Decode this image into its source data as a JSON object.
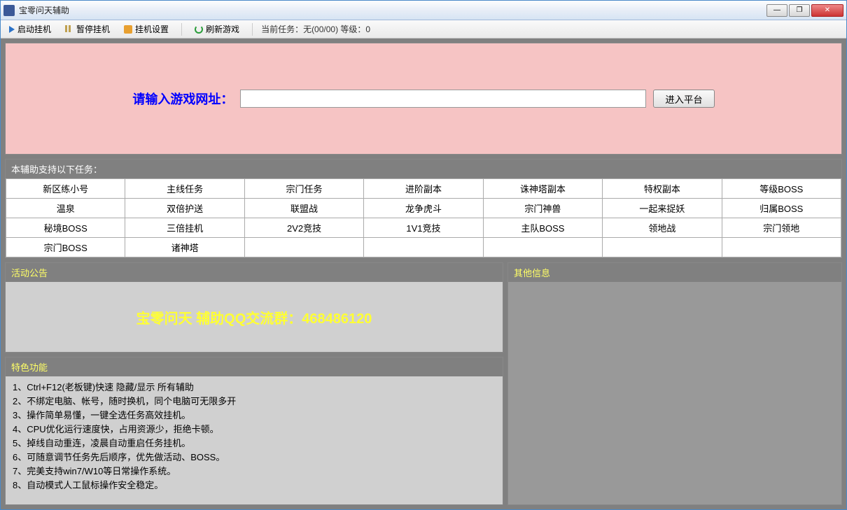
{
  "window": {
    "title": "宝零问天辅助"
  },
  "toolbar": {
    "start": "启动挂机",
    "pause": "暂停挂机",
    "settings": "挂机设置",
    "refresh": "刷新游戏",
    "status": "当前任务：无(00/00) 等级：0"
  },
  "url_panel": {
    "label": "请输入游戏网址：",
    "value": "",
    "button": "进入平台"
  },
  "tasks": {
    "header": "本辅助支持以下任务：",
    "rows": [
      [
        "新区练小号",
        "主线任务",
        "宗门任务",
        "进阶副本",
        "诛神塔副本",
        "特权副本",
        "等级BOSS"
      ],
      [
        "温泉",
        "双倍护送",
        "联盟战",
        "龙争虎斗",
        "宗门神兽",
        "一起来捉妖",
        "归属BOSS"
      ],
      [
        "秘境BOSS",
        "三倍挂机",
        "2V2竞技",
        "1V1竞技",
        "主队BOSS",
        "领地战",
        "宗门领地"
      ],
      [
        "宗门BOSS",
        "诸神塔",
        "",
        "",
        "",
        "",
        ""
      ]
    ]
  },
  "announce": {
    "header": "活动公告",
    "text": "宝零问天 辅助QQ交流群：468486120"
  },
  "features": {
    "header": "特色功能",
    "lines": [
      "1、Ctrl+F12(老板键)快速 隐藏/显示 所有辅助",
      "2、不绑定电脑、帐号，随时换机，同个电脑可无限多开",
      "3、操作简单易懂，一键全选任务高效挂机。",
      "4、CPU优化运行速度快，占用资源少，拒绝卡顿。",
      "5、掉线自动重连，凌晨自动重启任务挂机。",
      "6、可随意调节任务先后顺序，优先做活动、BOSS。",
      "7、完美支持win7/W10等日常操作系统。",
      "8、自动模式人工鼠标操作安全稳定。"
    ]
  },
  "other": {
    "header": "其他信息"
  }
}
